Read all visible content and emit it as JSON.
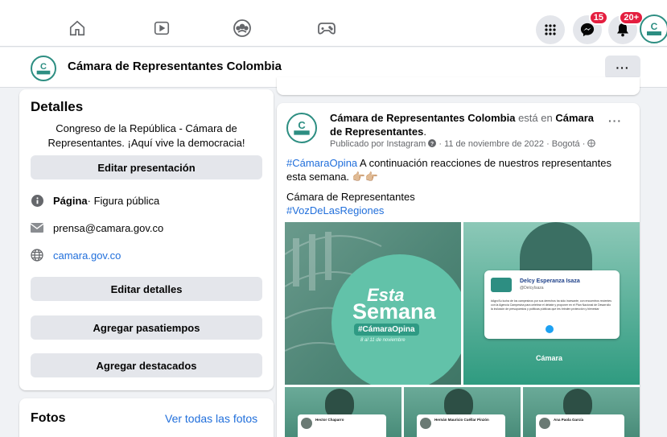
{
  "topnav": {
    "icons": [
      "home-icon",
      "watch-icon",
      "groups-icon",
      "gaming-icon",
      "menu-grid-icon",
      "messenger-icon",
      "notifications-icon"
    ],
    "messenger_badge": "15",
    "notifications_badge": "20+",
    "avatar_text": "Cámara"
  },
  "pagebar": {
    "page_name": "Cámara de Representantes Colombia",
    "logo_text": "Cámara",
    "more_label": "···"
  },
  "details": {
    "title": "Detalles",
    "bio": "Congreso de la República - Cámara de Representantes. ¡Aquí vive la democracia!",
    "edit_intro_label": "Editar presentación",
    "page_type_bold": "Página",
    "page_type_rest": " · Figura pública",
    "email": "prensa@camara.gov.co",
    "website": "camara.gov.co",
    "edit_details_label": "Editar detalles",
    "add_hobbies_label": "Agregar pasatiempos",
    "add_featured_label": "Agregar destacados"
  },
  "photos": {
    "title": "Fotos",
    "see_all": "Ver todas las fotos"
  },
  "post": {
    "author": "Cámara de Representantes Colombia",
    "connector": " está en ",
    "location": "Cámara de Representantes",
    "location_end": ".",
    "meta": "Publicado por Instagram",
    "date": " · 11 de noviembre de 2022 · Bogotá ·",
    "more_label": "···",
    "hashtag1": "#CámaraOpina",
    "text1": " A continuación reacciones de nuestros representantes esta semana. 👉🏼👉🏼",
    "text2": "Cámara de Representantes",
    "hashtag2": "#VozDeLasRegiones",
    "logo_text": "Cámara"
  },
  "images": {
    "big": {
      "line1": "Esta",
      "line2": "Semana",
      "tag": "#CámaraOpina",
      "dates": "8 al 11 de noviembre"
    },
    "side": {
      "tweet_name": "Delcy Esperanza Isaza",
      "tweet_handle": "@DelcyIsaza",
      "tweet_text": "#AgroSu lucha de los campesinos por sus derechos ha sido incesante, con encuentros recientes con la Agencia Campesina para celebrar el debate y proponer en el Plan Nacional de Desarrollo la inclusión de presupuestos y políticas públicas que les brinden protección y bienestar",
      "brand": "Cámara"
    },
    "row2": [
      {
        "name": "Hector Chaparro"
      },
      {
        "name": "Hernán Mauricio Cuéllar Pinzón"
      },
      {
        "name": "Ana Paola García"
      }
    ]
  },
  "colors": {
    "accent": "#216fdb",
    "badge": "#e41e3f",
    "brand_teal": "#2d8e82"
  }
}
